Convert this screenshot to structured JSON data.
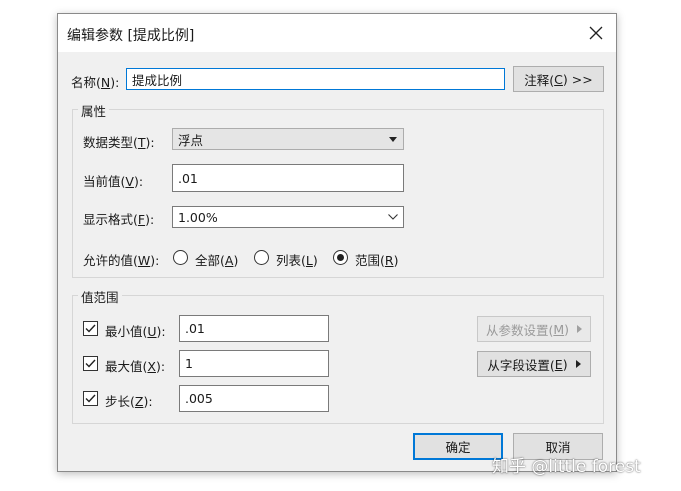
{
  "dialog": {
    "title": "编辑参数 [提成比例]"
  },
  "name_row": {
    "label_pre": "名称(",
    "label_key": "N",
    "label_post": "):",
    "value": "提成比例",
    "comment_button": {
      "pre": "注释(",
      "key": "C",
      "post": ") >>"
    }
  },
  "properties": {
    "group_title": "属性",
    "data_type": {
      "label_pre": "数据类型(",
      "label_key": "T",
      "label_post": "):",
      "value": "浮点"
    },
    "current_value": {
      "label_pre": "当前值(",
      "label_key": "V",
      "label_post": "):",
      "value": ".01"
    },
    "display_format": {
      "label_pre": "显示格式(",
      "label_key": "F",
      "label_post": "):",
      "value": "1.00%"
    },
    "allowed": {
      "label_pre": "允许的值(",
      "label_key": "W",
      "label_post": "):",
      "options": [
        {
          "pre": "全部(",
          "key": "A",
          "post": ")",
          "selected": false
        },
        {
          "pre": "列表(",
          "key": "L",
          "post": ")",
          "selected": false
        },
        {
          "pre": "范围(",
          "key": "R",
          "post": ")",
          "selected": true
        }
      ]
    }
  },
  "range": {
    "group_title": "值范围",
    "min": {
      "pre": "最小值(",
      "key": "U",
      "post": "):",
      "value": ".01",
      "checked": true
    },
    "max": {
      "pre": "最大值(",
      "key": "X",
      "post": "):",
      "value": "1",
      "checked": true
    },
    "step": {
      "pre": "步长(",
      "key": "Z",
      "post": "):",
      "value": ".005",
      "checked": true
    },
    "from_param_button": {
      "pre": "从参数设置(",
      "key": "M",
      "post": ")",
      "disabled": true
    },
    "from_field_button": {
      "pre": "从字段设置(",
      "key": "E",
      "post": ")",
      "disabled": false
    }
  },
  "footer": {
    "ok_label": "确定",
    "cancel_label": "取消"
  },
  "watermark": "知乎 @little forest",
  "colors": {
    "accent": "#0078d7",
    "dialog_bg": "#f0f0f0"
  }
}
